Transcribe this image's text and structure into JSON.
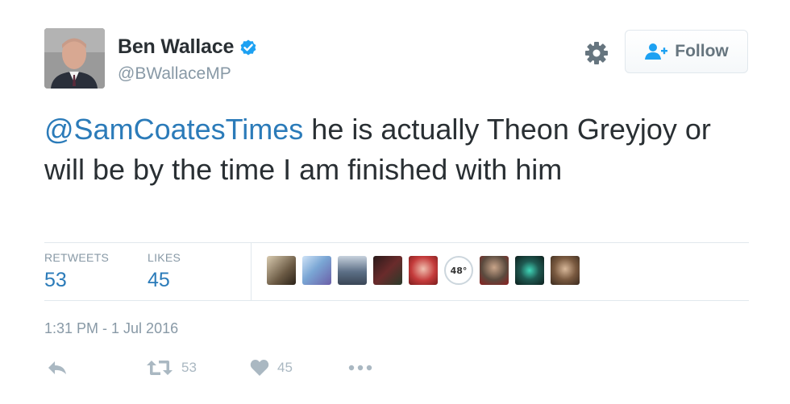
{
  "user": {
    "display_name": "Ben Wallace",
    "handle": "@BWallaceMP",
    "verified": true
  },
  "follow_button": {
    "label": "Follow"
  },
  "tweet": {
    "mention": "@SamCoatesTimes",
    "text": " he is actually Theon Greyjoy or will be by the time I am finished with him"
  },
  "stats": {
    "retweets_label": "RETWEETS",
    "retweets_value": "53",
    "likes_label": "LIKES",
    "likes_value": "45"
  },
  "likers": [
    {
      "name": "liker-avatar-1",
      "color": "#6b5a44"
    },
    {
      "name": "liker-avatar-2",
      "color": "#7aa6d4"
    },
    {
      "name": "liker-avatar-3",
      "color": "#5c6f86"
    },
    {
      "name": "liker-avatar-4",
      "color": "#6a2b2b"
    },
    {
      "name": "liker-avatar-5",
      "color": "#c43b3b"
    },
    {
      "name": "liker-avatar-6",
      "badge": "48°"
    },
    {
      "name": "liker-avatar-7",
      "color": "#5a4a3e"
    },
    {
      "name": "liker-avatar-8",
      "color": "#1f5a52"
    },
    {
      "name": "liker-avatar-9",
      "color": "#7a5a40"
    }
  ],
  "timestamp": "1:31 PM - 1 Jul 2016",
  "actions": {
    "reply_icon": "reply-icon",
    "retweet_icon": "retweet-icon",
    "retweet_count": "53",
    "like_icon": "heart-icon",
    "like_count": "45",
    "more_icon": "more-icon"
  },
  "colors": {
    "link": "#2b7bb9",
    "verified": "#1da1f2",
    "muted": "#8899a6",
    "action": "#aab8c2"
  }
}
